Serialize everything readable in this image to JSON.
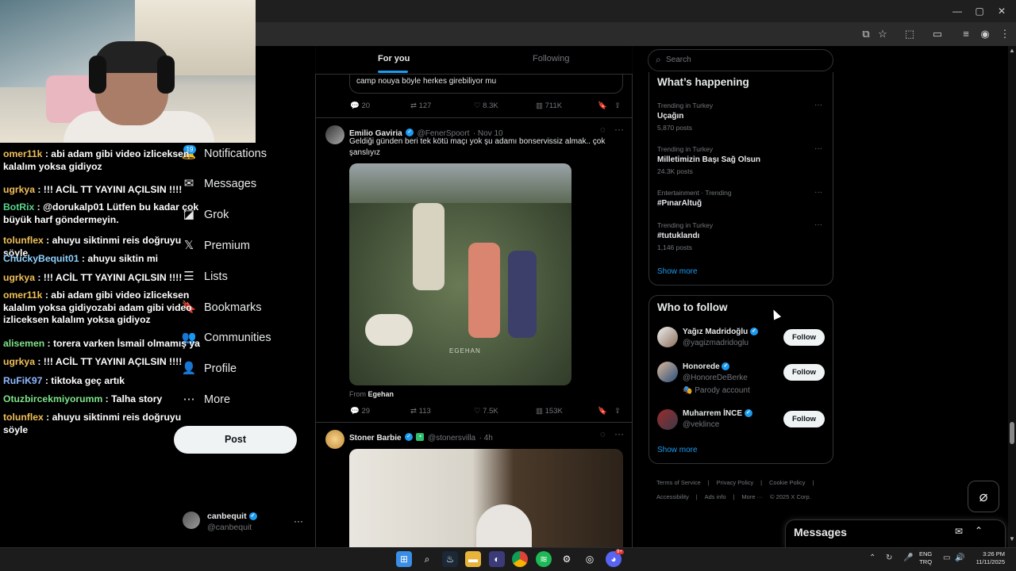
{
  "browser": {
    "window_controls": [
      "—",
      "▢",
      "✕"
    ],
    "toolbar_icons": [
      "cast-icon",
      "star-icon",
      "extensions-icon",
      "split-icon",
      "reading-list-icon",
      "profile-icon",
      "menu-icon"
    ]
  },
  "chat": [
    {
      "user": "omer11k",
      "color": "#f0c05a",
      "text": " : abi adam gibi video izliceksen kalalım yoksa gidiyoz"
    },
    {
      "user": "ugrkya",
      "color": "#f0c05a",
      "text": " : !!! ACİL TT YAYINI AÇILSIN !!!!"
    },
    {
      "user": "BotRix",
      "color": "#58d68d",
      "text": " : @dorukalp01 Lütfen bu kadar çok büyük harf göndermeyin."
    },
    {
      "user": "tolunflex",
      "color": "#f0c05a",
      "text": " : ahuyu siktinmi reis doğruyu söyle"
    },
    {
      "user": "ChuckyBequit01",
      "color": "#8fd3ff",
      "text": " : ahuyu siktin mi"
    },
    {
      "user": "ugrkya",
      "color": "#f0c05a",
      "text": " : !!! ACİL TT YAYINI AÇILSIN !!!!"
    },
    {
      "user": "omer11k",
      "color": "#f0c05a",
      "text": " : abi adam gibi video izliceksen kalalım yoksa gidiyozabi adam gibi video izliceksen kalalım yoksa gidiyoz"
    },
    {
      "user": "alisemen",
      "color": "#7ee38a",
      "text": " : torera varken İsmail olmamış ya"
    },
    {
      "user": "ugrkya",
      "color": "#f0c05a",
      "text": " : !!! ACİL TT YAYINI AÇILSIN !!!!"
    },
    {
      "user": "RuFiK97",
      "color": "#8fb8ff",
      "text": " : tiktoka geç artık"
    },
    {
      "user": "Otuzbircekmiyorumm",
      "color": "#7ee38a",
      "text": " : Talha story"
    },
    {
      "user": "tolunflex",
      "color": "#f0c05a",
      "text": " : ahuyu siktinmi reis doğruyu söyle"
    }
  ],
  "nav": {
    "badge": "19",
    "items": [
      {
        "label": "Notifications",
        "icon": "bell-icon",
        "glyph": "🔔"
      },
      {
        "label": "Messages",
        "icon": "envelope-icon",
        "glyph": "✉"
      },
      {
        "label": "Grok",
        "icon": "grok-icon",
        "glyph": "◪"
      },
      {
        "label": "Premium",
        "icon": "x-logo-icon",
        "glyph": "𝕏"
      },
      {
        "label": "Lists",
        "icon": "list-icon",
        "glyph": "☰"
      },
      {
        "label": "Bookmarks",
        "icon": "bookmark-icon",
        "glyph": "🔖"
      },
      {
        "label": "Communities",
        "icon": "people-icon",
        "glyph": "👥"
      },
      {
        "label": "Profile",
        "icon": "person-icon",
        "glyph": "👤"
      },
      {
        "label": "More",
        "icon": "more-circle-icon",
        "glyph": "⋯"
      }
    ],
    "post_label": "Post",
    "account": {
      "name": "canbequit",
      "handle": "@canbequit",
      "more": "···"
    }
  },
  "timeline": {
    "tabs": {
      "for_you": "For you",
      "following": "Following"
    },
    "tweet1": {
      "quote_text": "camp nouya böyle herkes girebiliyor mu",
      "replies": "20",
      "reposts": "127",
      "likes": "8.3K",
      "views": "711K"
    },
    "tweet2": {
      "name": "Emilio Gaviria",
      "handle": "@FenerSpoort",
      "time": "· Nov 10",
      "text": "Geldiği günden beri tek kötü maçı yok şu adamı bonservissiz almak.. çok şanslıyız",
      "media_watermark": "EGEHAN",
      "from_label": "From",
      "from_name": "Egehan",
      "replies": "29",
      "reposts": "113",
      "likes": "7.5K",
      "views": "153K"
    },
    "tweet3": {
      "name": "Stoner Barbie",
      "handle": "@stonersvilla",
      "time": "· 4h"
    }
  },
  "sidebar": {
    "search_placeholder": "Search",
    "trends_title": "What’s happening",
    "trends": [
      {
        "meta": "Trending in Turkey",
        "name": "Uçağın",
        "count": "5,870 posts"
      },
      {
        "meta": "Trending in Turkey",
        "name": "Milletimizin Başı Sağ Olsun",
        "count": "24.3K posts"
      },
      {
        "meta": "Entertainment · Trending",
        "name": "#PınarAltuğ",
        "count": ""
      },
      {
        "meta": "Trending in Turkey",
        "name": "#tutuklandı",
        "count": "1,146 posts"
      }
    ],
    "show_more": "Show more",
    "wtf_title": "Who to follow",
    "wtf": [
      {
        "name": "Yağız Madridoğlu",
        "handle": "@yagizmadridoglu",
        "extra": "",
        "follow": "Follow"
      },
      {
        "name": "Honorede",
        "handle": "@HonoreDeBerke",
        "extra": "Parody account",
        "follow": "Follow"
      },
      {
        "name": "Muharrem İNCE",
        "handle": "@veklince",
        "extra": "",
        "follow": "Follow"
      }
    ],
    "footer": [
      "Terms of Service",
      "|",
      "Privacy Policy",
      "|",
      "Cookie Policy",
      "|",
      "Accessibility",
      "|",
      "Ads info",
      "|",
      "More ···",
      "© 2025 X Corp."
    ]
  },
  "messages_drawer": {
    "title": "Messages"
  },
  "taskbar": {
    "lang_top": "ENG",
    "lang_bottom": "TRQ",
    "time": "3:26 PM",
    "date": "11/11/2025",
    "icons": [
      "windows-start-icon",
      "search-icon",
      "steam-icon",
      "file-explorer-icon",
      "app-icon",
      "chrome-icon",
      "spotify-icon",
      "settings-icon",
      "capture-icon",
      "discord-icon"
    ],
    "discord_badge": "9+"
  }
}
